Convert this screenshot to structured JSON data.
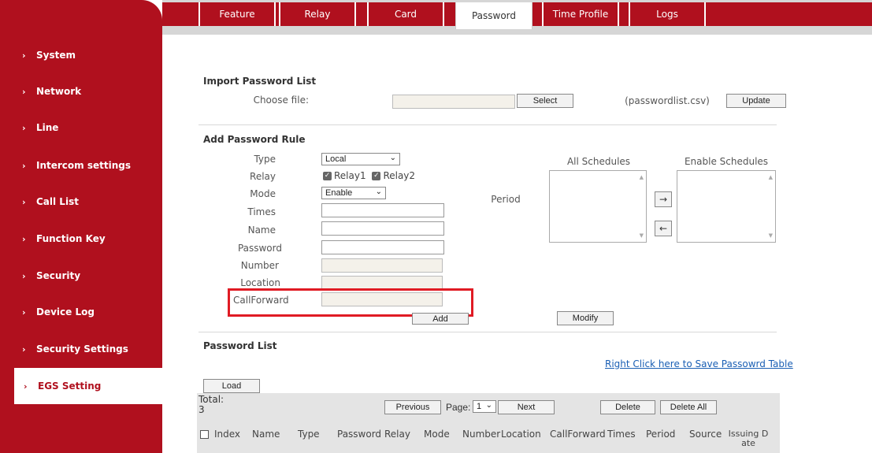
{
  "sidebar": {
    "items": [
      {
        "label": "System"
      },
      {
        "label": "Network"
      },
      {
        "label": "Line"
      },
      {
        "label": "Intercom settings"
      },
      {
        "label": "Call List"
      },
      {
        "label": "Function Key"
      },
      {
        "label": "Security"
      },
      {
        "label": "Device Log"
      },
      {
        "label": "Security Settings"
      },
      {
        "label": "EGS Setting"
      }
    ],
    "active_index": 9,
    "chevron": "›"
  },
  "tabs": [
    {
      "label": "Feature"
    },
    {
      "label": "Relay"
    },
    {
      "label": "Card"
    },
    {
      "label": "Password"
    },
    {
      "label": "Time Profile"
    },
    {
      "label": "Logs"
    }
  ],
  "active_tab": "Password",
  "import": {
    "title": "Import Password List",
    "choose_label": "Choose file:",
    "file_value": "",
    "select_btn": "Select",
    "file_hint": "(passwordlist.csv)",
    "update_btn": "Update"
  },
  "add_rule": {
    "title": "Add Password Rule",
    "type_label": "Type",
    "type_value": "Local",
    "relay_label": "Relay",
    "relay1": "Relay1",
    "relay2": "Relay2",
    "mode_label": "Mode",
    "mode_value": "Enable",
    "times_label": "Times",
    "name_label": "Name",
    "password_label": "Password",
    "number_label": "Number",
    "location_label": "Location",
    "callforward_label": "CallForward",
    "period_label": "Period",
    "all_schedules": "All Schedules",
    "enable_schedules": "Enable Schedules",
    "add_btn": "Add",
    "modify_btn": "Modify",
    "right_arrow": "→",
    "left_arrow": "←"
  },
  "password_list": {
    "title": "Password List",
    "save_link": "Right Click here to Save Passowrd Table",
    "load_btn": "Load",
    "total_label": "Total:",
    "total_value": "3",
    "previous_btn": "Previous",
    "page_label": "Page:",
    "page_value": "1",
    "next_btn": "Next",
    "delete_btn": "Delete",
    "delete_all_btn": "Delete All",
    "columns": [
      "Index",
      "Name",
      "Type",
      "Password",
      "Relay",
      "Mode",
      "Number",
      "Location",
      "CallForward",
      "Times",
      "Period",
      "Source",
      "Issuing D",
      "ate"
    ]
  },
  "colors": {
    "brand_red": "#b0101e",
    "highlight": "#e01b24",
    "link": "#1a5fb4"
  }
}
